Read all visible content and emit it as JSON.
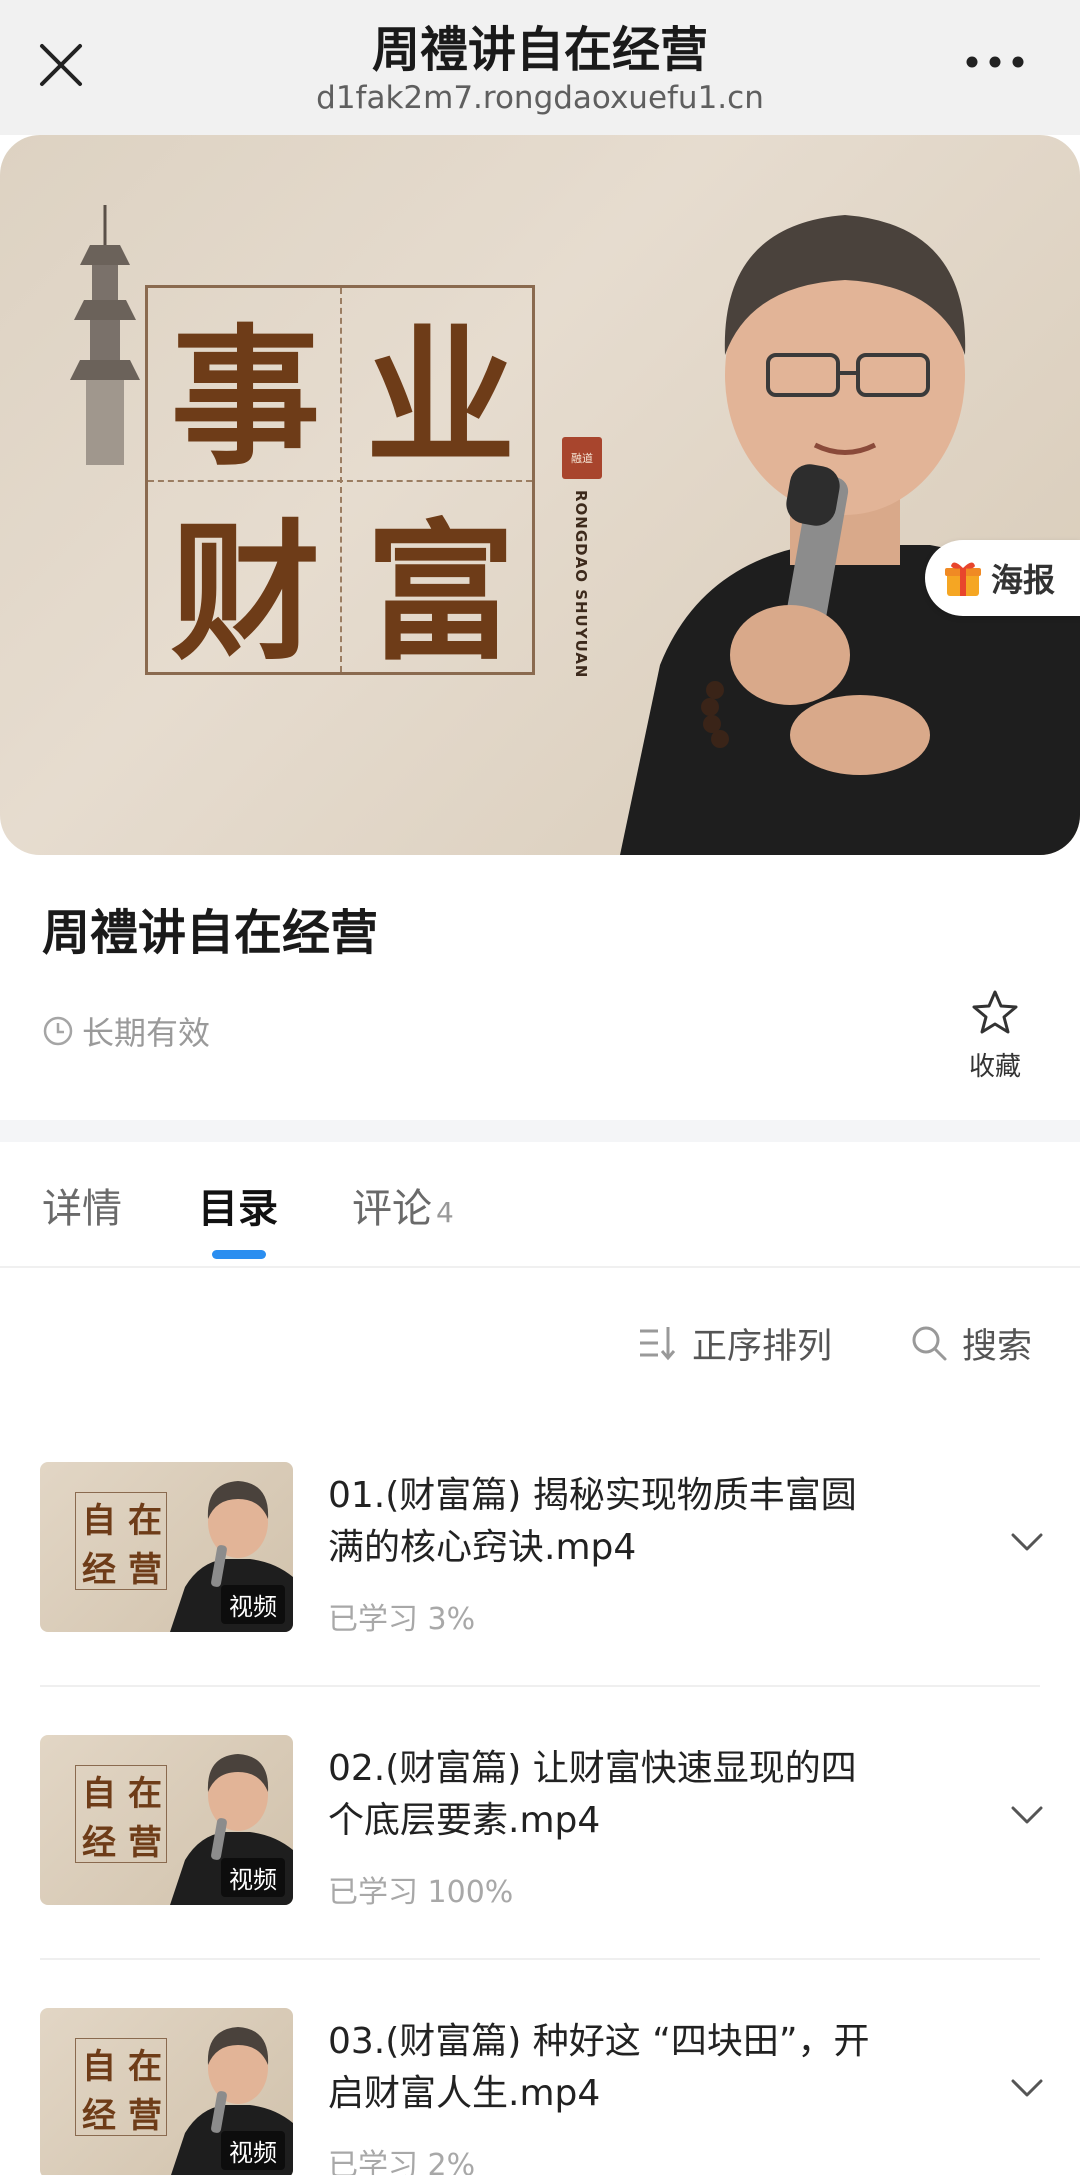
{
  "header": {
    "title": "周禮讲自在经营",
    "url": "d1fak2m7.rongdaoxuefu1.cn"
  },
  "banner": {
    "chars": [
      "事",
      "业",
      "财",
      "富"
    ],
    "seal_text": "融道",
    "brand": "RONGDAO SHUYUAN",
    "poster_label": "海报"
  },
  "course": {
    "title": "周禮讲自在经营",
    "validity": "长期有效",
    "favorite_label": "收藏"
  },
  "tabs": [
    {
      "label": "详情",
      "badge": ""
    },
    {
      "label": "目录",
      "badge": ""
    },
    {
      "label": "评论",
      "badge": "4"
    }
  ],
  "tools": {
    "sort_label": "正序排列",
    "search_label": "搜索"
  },
  "lessons": [
    {
      "title": "01.(财富篇) 揭秘实现物质丰富圆满的核心窍诀.mp4",
      "progress": "已学习 3%",
      "tag": "视频"
    },
    {
      "title": "02.(财富篇) 让财富快速显现的四个底层要素.mp4",
      "progress": "已学习 100%",
      "tag": "视频"
    },
    {
      "title": "03.(财富篇) 种好这 “四块田”，开启财富人生.mp4",
      "progress": "已学习 2%",
      "tag": "视频"
    }
  ],
  "thumb_chars": [
    "自",
    "在",
    "经",
    "营"
  ],
  "colors": {
    "accent": "#2b8ef0",
    "brown": "#6e3c18"
  }
}
